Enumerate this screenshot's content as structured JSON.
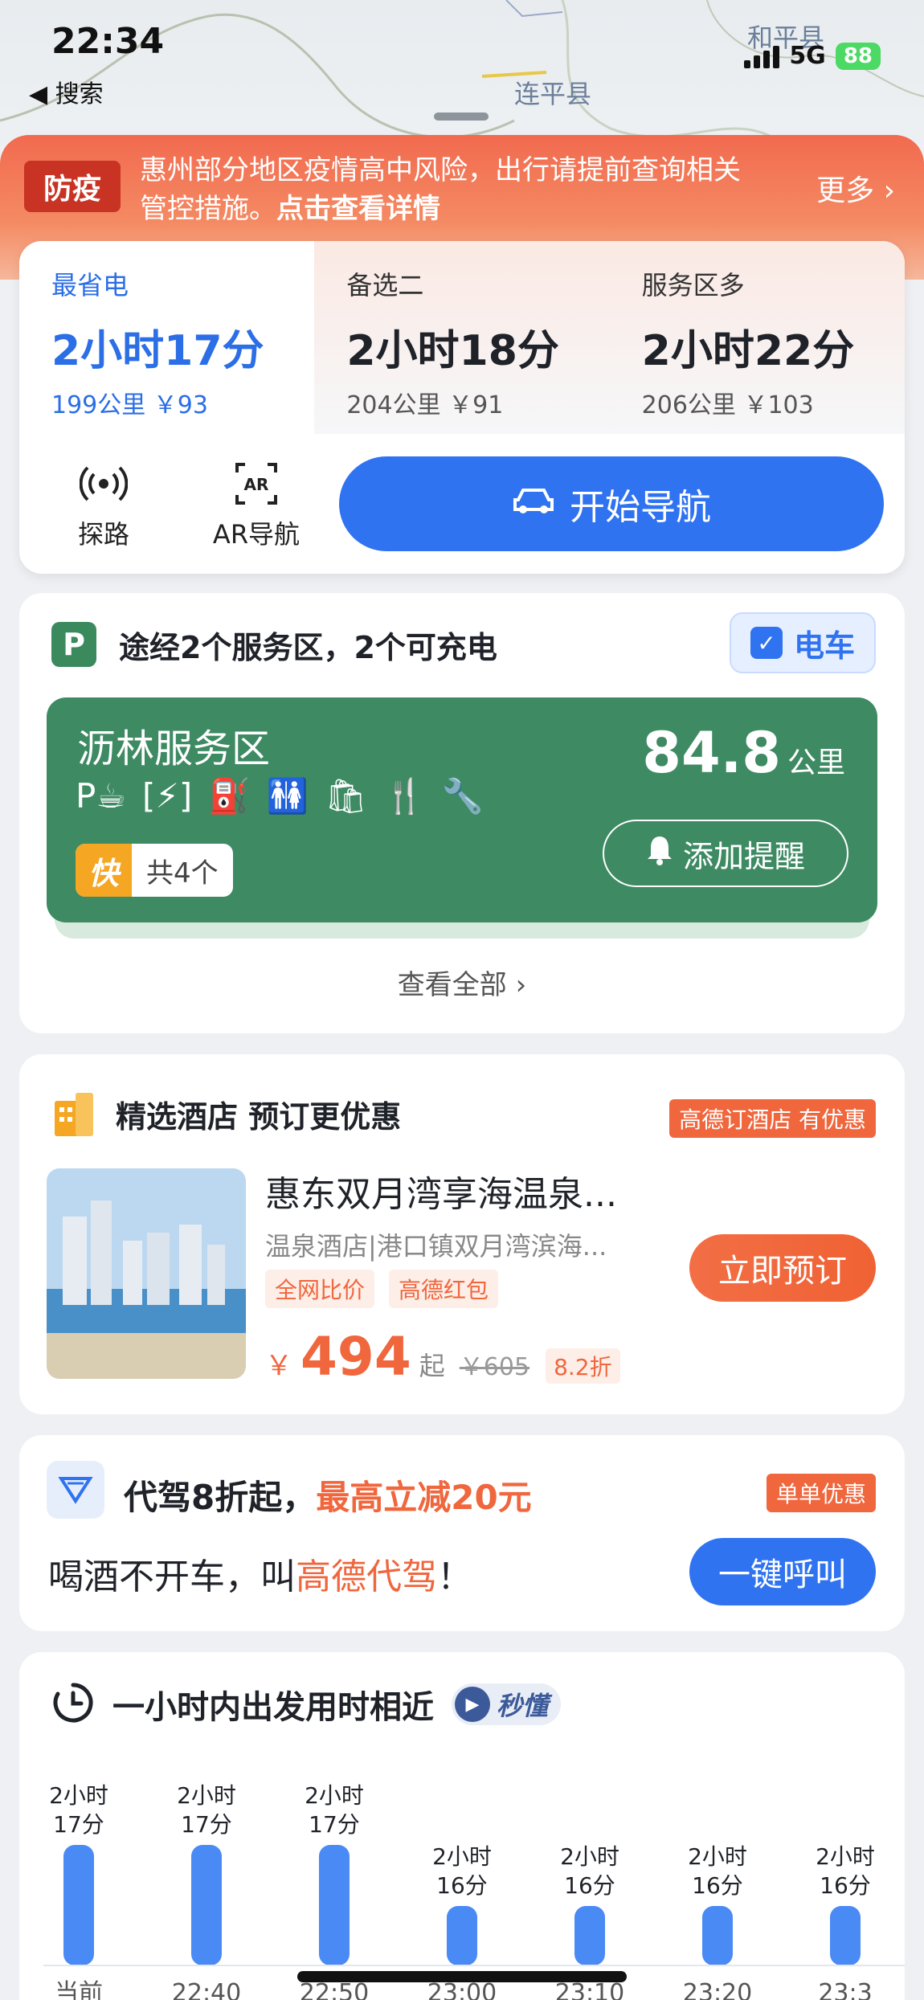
{
  "status_bar": {
    "time": "22:34",
    "back_label": "◀ 搜索",
    "network": "5G",
    "battery": "88"
  },
  "map": {
    "labels": [
      "连平县",
      "和平县"
    ]
  },
  "alert": {
    "tag": "防疫",
    "text_plain": "惠州部分地区疫情高中风险，出行请提前查询相关管控措施。",
    "text_link": "点击查看详情",
    "more": "更多 ›"
  },
  "routes": [
    {
      "label": "最省电",
      "duration": "2小时17分",
      "meta": "199公里 ￥93",
      "active": true
    },
    {
      "label": "备选二",
      "duration": "2小时18分",
      "meta": "204公里 ￥91",
      "active": false
    },
    {
      "label": "服务区多",
      "duration": "2小时22分",
      "meta": "206公里 ￥103",
      "active": false
    }
  ],
  "tools": [
    {
      "icon": "probe-road-icon",
      "label": "探路"
    },
    {
      "icon": "ar-nav-icon",
      "label": "AR导航"
    }
  ],
  "start_nav_label": "开始导航",
  "service": {
    "title": "途经2个服务区，2个可充电",
    "ev_chip": "电车",
    "area_name": "沥林服务区",
    "distance": "84.8",
    "distance_unit": "公里",
    "fast_tag": "快",
    "fast_count": "共4个",
    "remind_label": "添加提醒",
    "see_all": "查看全部 ›",
    "icons": [
      "parking-icon",
      "charging-icon",
      "fuel-icon",
      "toilet-icon",
      "store-icon",
      "food-icon",
      "repair-icon"
    ]
  },
  "hotel": {
    "title": "精选酒店 预订更优惠",
    "tag": "高德订酒店 有优惠",
    "name": "惠东双月湾享海温泉...",
    "sub": "温泉酒店|港口镇双月湾滨海...",
    "badges": [
      "全网比价",
      "高德红包"
    ],
    "currency": "￥",
    "price": "494",
    "price_suffix": "起",
    "original_price": "￥605",
    "discount": "8.2折",
    "book_label": "立即预订"
  },
  "driver": {
    "title_plain": "代驾8折起，",
    "title_highlight": "最高立减20元",
    "tag": "单单优惠",
    "text_before": "喝酒不开车，叫",
    "text_highlight": "高德代驾",
    "text_after": "！",
    "call_label": "一键呼叫"
  },
  "departure": {
    "title": "一小时内出发用时相近",
    "chip": "秒懂"
  },
  "chart_data": {
    "type": "bar",
    "categories": [
      "当前",
      "22:40",
      "22:50",
      "23:00",
      "23:10",
      "23:20",
      "23:3"
    ],
    "values": [
      137,
      137,
      137,
      136,
      136,
      136,
      136
    ],
    "value_labels": [
      [
        "2小时",
        "17分"
      ],
      [
        "2小时",
        "17分"
      ],
      [
        "2小时",
        "17分"
      ],
      [
        "2小时",
        "16分"
      ],
      [
        "2小时",
        "16分"
      ],
      [
        "2小时",
        "16分"
      ],
      [
        "2小时",
        "16分"
      ]
    ],
    "bar_color": "#4a8af4"
  }
}
